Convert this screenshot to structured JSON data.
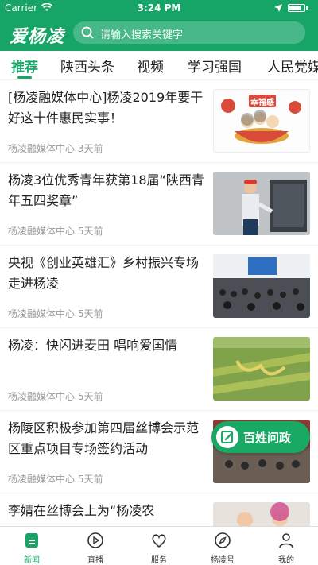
{
  "status": {
    "carrier": "Carrier",
    "time": "3:24 PM",
    "battery_level": 0.78
  },
  "header": {
    "logo": "爱杨凌",
    "search_placeholder": "请输入搜索关键字"
  },
  "tabs": [
    "推荐",
    "陕西头条",
    "视频",
    "学习强国",
    "人民党媒"
  ],
  "active_tab": "推荐",
  "news": [
    {
      "title": "[杨凌融媒体中心]杨凌2019年要干好这十件惠民实事！",
      "source": "杨凌融媒体中心",
      "time": "3天前",
      "thumb": "幸福感"
    },
    {
      "title": "杨凌3位优秀青年获第18届“陕西青年五四奖章”",
      "source": "杨凌融媒体中心",
      "time": "5天前"
    },
    {
      "title": "央视《创业英雄汇》乡村振兴专场走进杨凌",
      "source": "杨凌融媒体中心",
      "time": "5天前"
    },
    {
      "title": "杨凌：快闪进麦田 唱响爱国情",
      "source": "杨凌融媒体中心",
      "time": "5天前"
    },
    {
      "title": "杨陵区积极参加第四届丝博会示范区重点项目专场签约活动",
      "source": "杨凌融媒体中心",
      "time": "5天前"
    },
    {
      "title": "李婧在丝博会上为“杨凌农"
    }
  ],
  "float_button": {
    "label": "百姓问政"
  },
  "bottom_nav": [
    {
      "label": "新闻",
      "icon": "news-icon"
    },
    {
      "label": "直播",
      "icon": "live-icon"
    },
    {
      "label": "服务",
      "icon": "service-icon"
    },
    {
      "label": "杨凌号",
      "icon": "compass-icon"
    },
    {
      "label": "我的",
      "icon": "user-icon"
    }
  ],
  "colors": {
    "primary": "#17a567"
  }
}
